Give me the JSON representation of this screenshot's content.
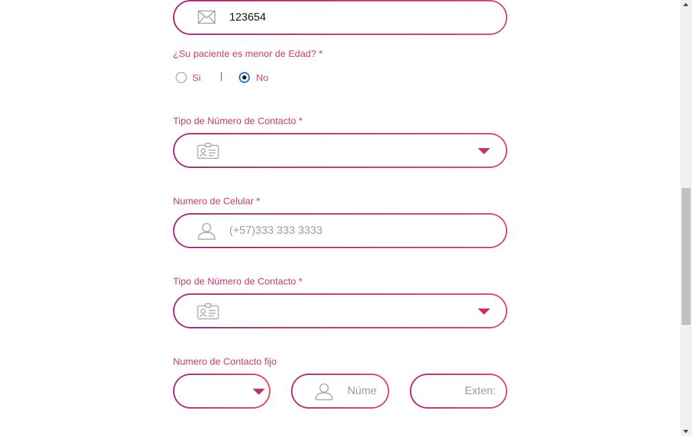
{
  "fields": {
    "code": {
      "value": "123654",
      "icon": "envelope-icon"
    },
    "minor_question": {
      "label": "¿Su paciente es menor de Edad? *",
      "options": [
        {
          "label": "Si",
          "checked": false
        },
        {
          "label": "No",
          "checked": true
        }
      ]
    },
    "contact_type_1": {
      "label": "Tipo de Número de Contacto *",
      "icon": "id-card-icon",
      "value": ""
    },
    "cell_number": {
      "label": "Numero de Celular *",
      "placeholder": "(+57)333 333 3333",
      "icon": "user-icon"
    },
    "contact_type_2": {
      "label": "Tipo de Número de Contacto *",
      "icon": "id-card-icon",
      "value": ""
    },
    "landline": {
      "label": "Numero de Contacto fijo",
      "prefix_value": "",
      "number_placeholder": "Núme",
      "extension_placeholder": "Exten:"
    }
  },
  "colors": {
    "label": "#cf3a72",
    "border_start": "#b01e7a",
    "border_end": "#e8405a",
    "caret": "#c8306c",
    "radio_checked": "#1a73e8"
  }
}
